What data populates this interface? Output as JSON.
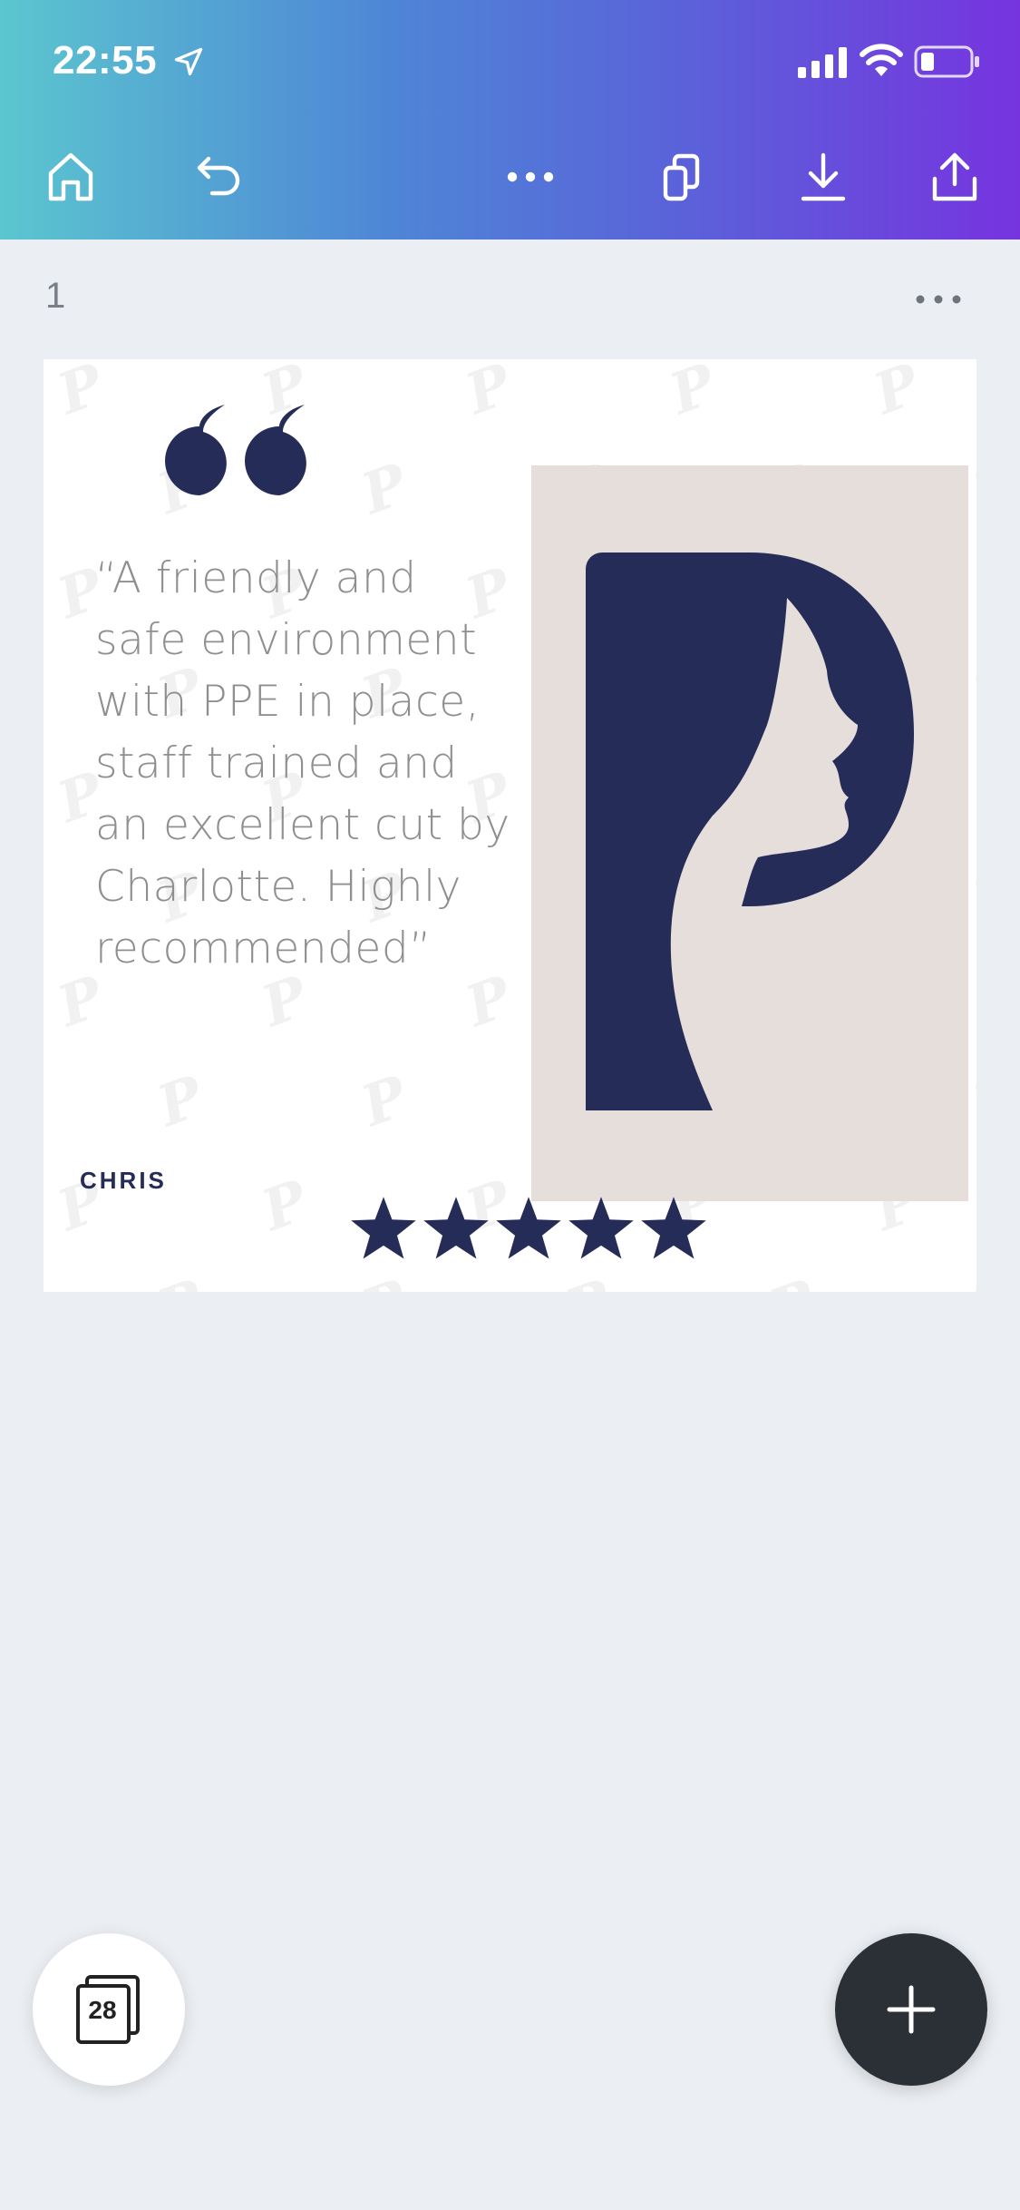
{
  "status_bar": {
    "time": "22:55",
    "location_icon": "location-arrow-icon",
    "signal_icon": "cellular-signal-icon",
    "wifi_icon": "wifi-icon",
    "battery_icon": "battery-low-icon"
  },
  "toolbar": {
    "home_icon": "home-icon",
    "undo_icon": "undo-icon",
    "more_icon": "more-horizontal-icon",
    "duplicate_icon": "duplicate-pages-icon",
    "download_icon": "download-icon",
    "share_icon": "share-icon"
  },
  "page": {
    "number": "1",
    "more_icon": "more-horizontal-icon"
  },
  "design": {
    "quote_mark_icon": "quote-mark-icon",
    "quote": "“A friendly and safe environment with PPE in place, staff trained and an excellent cut by Charlotte. Highly recommended”",
    "author": "CHRIS",
    "rating": 5,
    "rating_max": 5,
    "accent_color": "#262c58",
    "panel_color": "#e6dedb"
  },
  "bottom": {
    "pages_count": "28",
    "add_icon": "plus-icon"
  },
  "colors": {
    "header_gradient_start": "#5bc6cf",
    "header_gradient_end": "#7634df",
    "background": "#ebeef2",
    "fab_dark": "#2b2f36"
  }
}
